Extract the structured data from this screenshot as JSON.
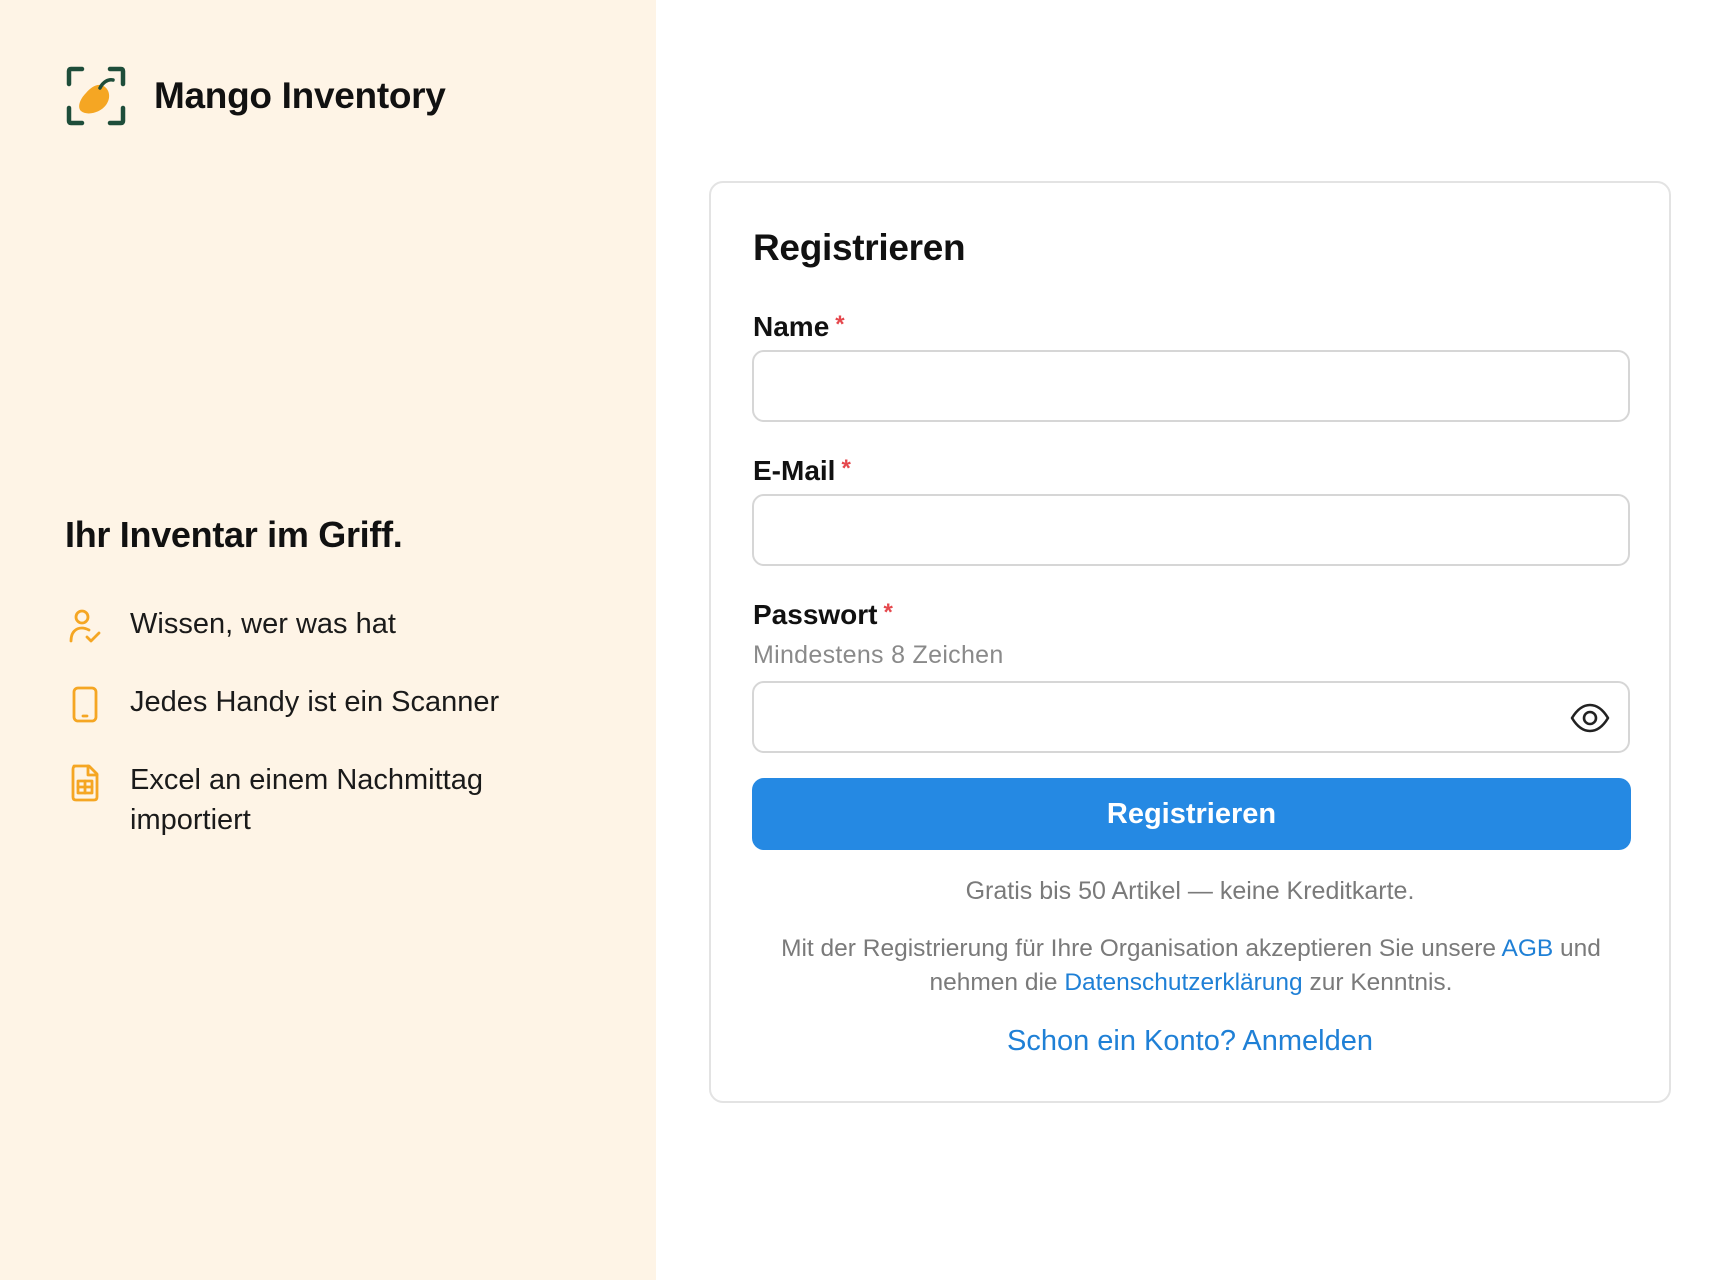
{
  "brand": {
    "name": "Mango Inventory",
    "colors": {
      "dark_green": "#1e4d3a",
      "mango": "#f5a623"
    }
  },
  "left_panel": {
    "background": "#fef4e6",
    "tagline": "Ihr Inventar im Griff.",
    "features": [
      {
        "icon": "user-check-icon",
        "text": "Wissen, wer was hat"
      },
      {
        "icon": "smartphone-icon",
        "text": "Jedes Handy ist ein Scanner"
      },
      {
        "icon": "spreadsheet-file-icon",
        "text": "Excel an einem Nachmittag importiert"
      }
    ]
  },
  "form": {
    "title": "Registrieren",
    "name": {
      "label": "Name",
      "required_mark": "*",
      "value": "",
      "placeholder": ""
    },
    "email": {
      "label": "E-Mail",
      "required_mark": "*",
      "value": "",
      "placeholder": ""
    },
    "password": {
      "label": "Passwort",
      "required_mark": "*",
      "hint": "Mindestens 8 Zeichen",
      "value": "",
      "placeholder": "",
      "toggle_icon": "eye-icon"
    },
    "submit_label": "Registrieren",
    "free_note": "Gratis bis 50 Artikel — keine Kreditkarte.",
    "legal": {
      "part1": "Mit der Registrierung für Ihre Organisation akzeptieren Sie unsere ",
      "agb_link": "AGB",
      "part2": " und nehmen die ",
      "privacy_link": "Datenschutzerklärung",
      "part3": " zur Kenntnis."
    },
    "login_link": "Schon ein Konto? Anmelden"
  },
  "colors": {
    "accent_blue": "#2589e3",
    "link_blue": "#1f80d6",
    "required_red": "#e5484d",
    "muted_text": "#7a7a7a",
    "feature_icon": "#f5a623"
  }
}
